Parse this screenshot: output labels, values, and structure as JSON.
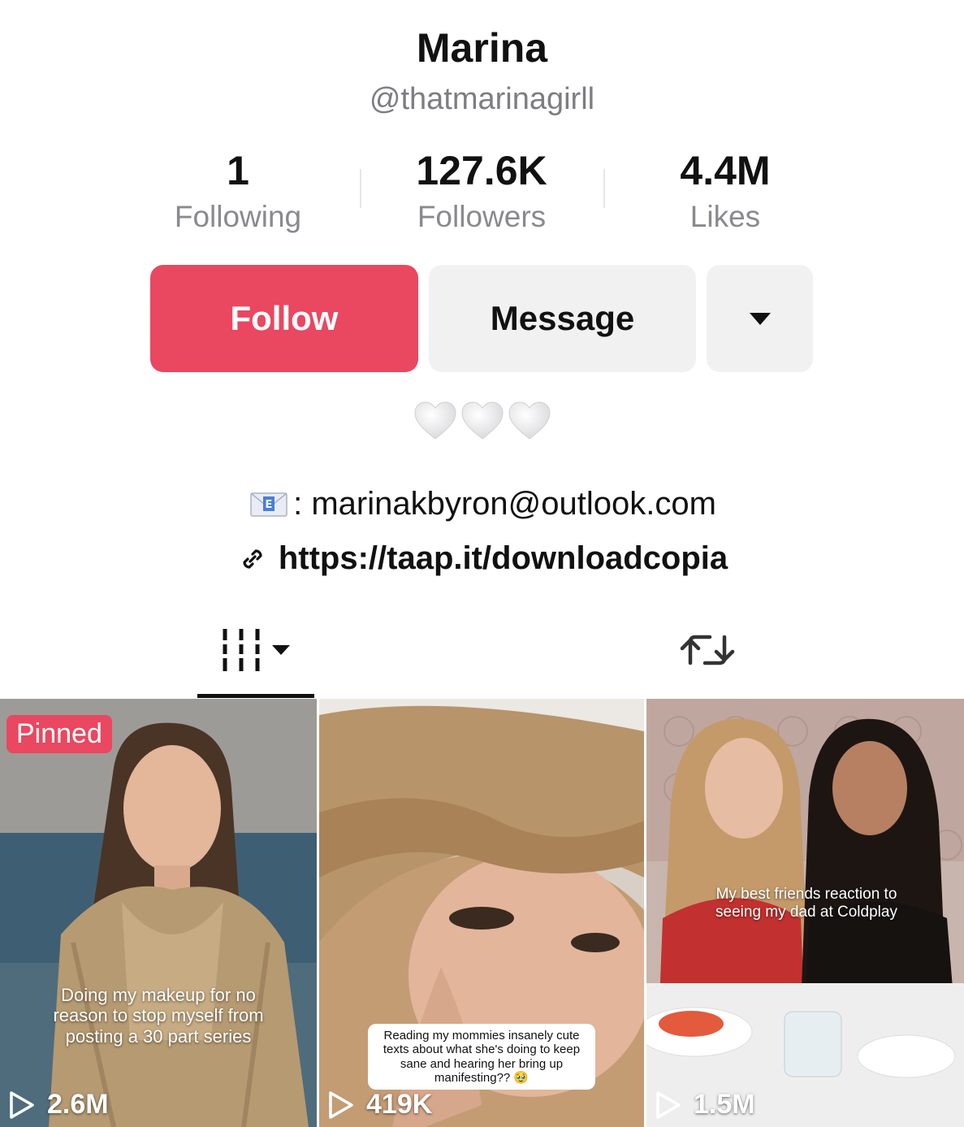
{
  "profile": {
    "name": "Marina",
    "handle": "@thatmarinagirll"
  },
  "stats": [
    {
      "value": "1",
      "label": "Following"
    },
    {
      "value": "127.6K",
      "label": "Followers"
    },
    {
      "value": "4.4M",
      "label": "Likes"
    }
  ],
  "actions": {
    "follow_label": "Follow",
    "message_label": "Message",
    "more_icon": "caret-down-icon"
  },
  "bio": {
    "hearts": "🤍🤍🤍",
    "email_prefix": ": ",
    "email": "marinakbyron@outlook.com",
    "link": "https://taap.it/downloadcopia"
  },
  "tabs": {
    "videos_icon": "grid-icon",
    "repost_icon": "repost-icon"
  },
  "videos": [
    {
      "pinned": "Pinned",
      "caption": "Doing my makeup for no reason to stop myself from posting a 30 part series",
      "views": "2.6M"
    },
    {
      "caption": "Reading my mommies insanely cute texts about what she's doing to keep sane and hearing her bring up manifesting?? 🥹",
      "views": "419K"
    },
    {
      "caption": "My best friends reaction to seeing my dad at Coldplay",
      "views": "1.5M"
    }
  ],
  "colors": {
    "accent": "#ea4760",
    "secondary_button": "#f1f1f2",
    "muted_text": "#8a8a8e"
  }
}
